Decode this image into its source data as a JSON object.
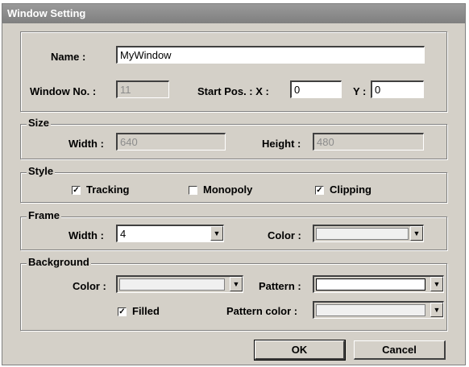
{
  "window": {
    "title": "Window Setting"
  },
  "top": {
    "name_label": "Name :",
    "name_value": "MyWindow",
    "window_no_label": "Window No. :",
    "window_no_value": "11",
    "start_pos_label": "Start Pos. : X :",
    "x_value": "0",
    "y_label": "Y :",
    "y_value": "0"
  },
  "size": {
    "legend": "Size",
    "width_label": "Width :",
    "width_value": "640",
    "height_label": "Height :",
    "height_value": "480"
  },
  "style": {
    "legend": "Style",
    "options": [
      {
        "label": "Tracking",
        "checked": true,
        "mark": "☑"
      },
      {
        "label": "Monopoly",
        "checked": false,
        "mark": ""
      },
      {
        "label": "Clipping",
        "checked": true,
        "mark": "☑"
      }
    ]
  },
  "frame": {
    "legend": "Frame",
    "width_label": "Width :",
    "width_value": "4",
    "color_label": "Color :"
  },
  "background": {
    "legend": "Background",
    "color_label": "Color :",
    "pattern_label": "Pattern :",
    "filled_label": "Filled",
    "filled_checked": true,
    "filled_mark": "☑",
    "pattern_color_label": "Pattern color :"
  },
  "buttons": {
    "ok": "OK",
    "cancel": "Cancel"
  },
  "icons": {
    "dropdown": "chevron-down-icon",
    "check": "checkmark-icon"
  }
}
